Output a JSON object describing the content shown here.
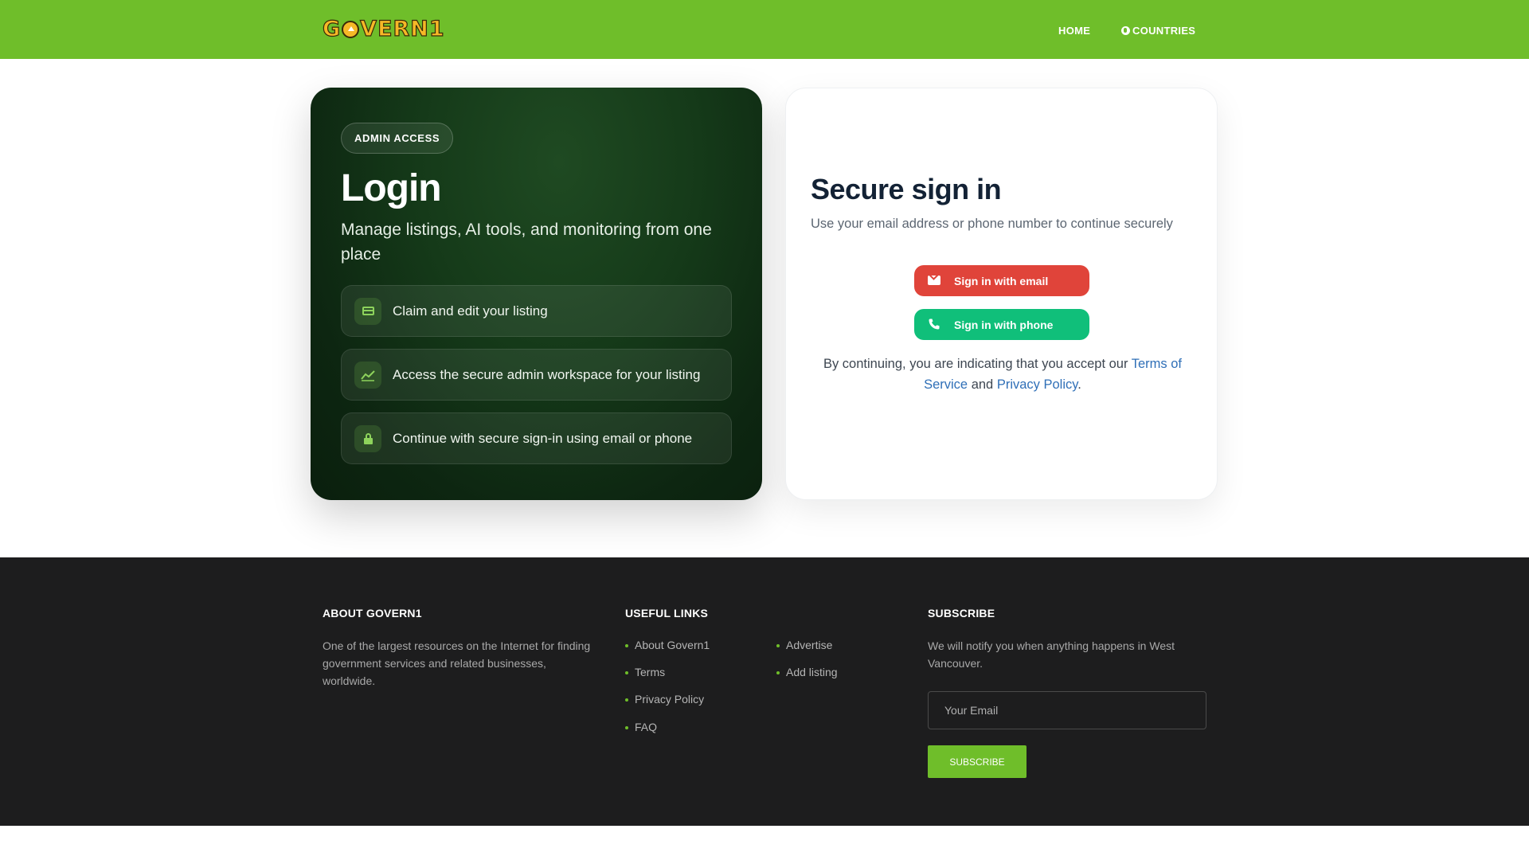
{
  "header": {
    "logo_text": "GOVERN1",
    "nav": {
      "home": "HOME",
      "countries": "COUNTRIES"
    },
    "background_color": "#6fbe2a"
  },
  "login_panel": {
    "badge": "ADMIN ACCESS",
    "title": "Login",
    "subtitle": "Manage listings, AI tools, and monitoring from one place",
    "features": [
      {
        "icon": "id-card-icon",
        "label": "Claim and edit your listing"
      },
      {
        "icon": "trend-chart-icon",
        "label": "Access the secure admin workspace for your listing"
      },
      {
        "icon": "lock-icon",
        "label": "Continue with secure sign-in using email or phone"
      }
    ]
  },
  "signin_panel": {
    "title": "Secure sign in",
    "subtitle": "Use your email address or phone number to continue securely",
    "email_button": "Sign in with email",
    "phone_button": "Sign in with phone",
    "terms_prefix": "By continuing, you are indicating that you accept our ",
    "terms_link": "Terms of Service",
    "terms_and": " and ",
    "privacy_link": "Privacy Policy",
    "terms_suffix": ".",
    "email_button_color": "#e0443a",
    "phone_button_color": "#10bf7a"
  },
  "footer": {
    "about": {
      "heading": "ABOUT GOVERN1",
      "text": "One of the largest resources on the Internet for finding government services and related businesses, worldwide."
    },
    "links": {
      "heading": "USEFUL LINKS",
      "col1": [
        "About Govern1",
        "Terms",
        "Privacy Policy",
        "FAQ"
      ],
      "col2": [
        "Advertise",
        "Add listing"
      ]
    },
    "subscribe": {
      "heading": "SUBSCRIBE",
      "text": "We will notify you when anything happens in West Vancouver.",
      "placeholder": "Your Email",
      "button": "SUBSCRIBE"
    }
  }
}
